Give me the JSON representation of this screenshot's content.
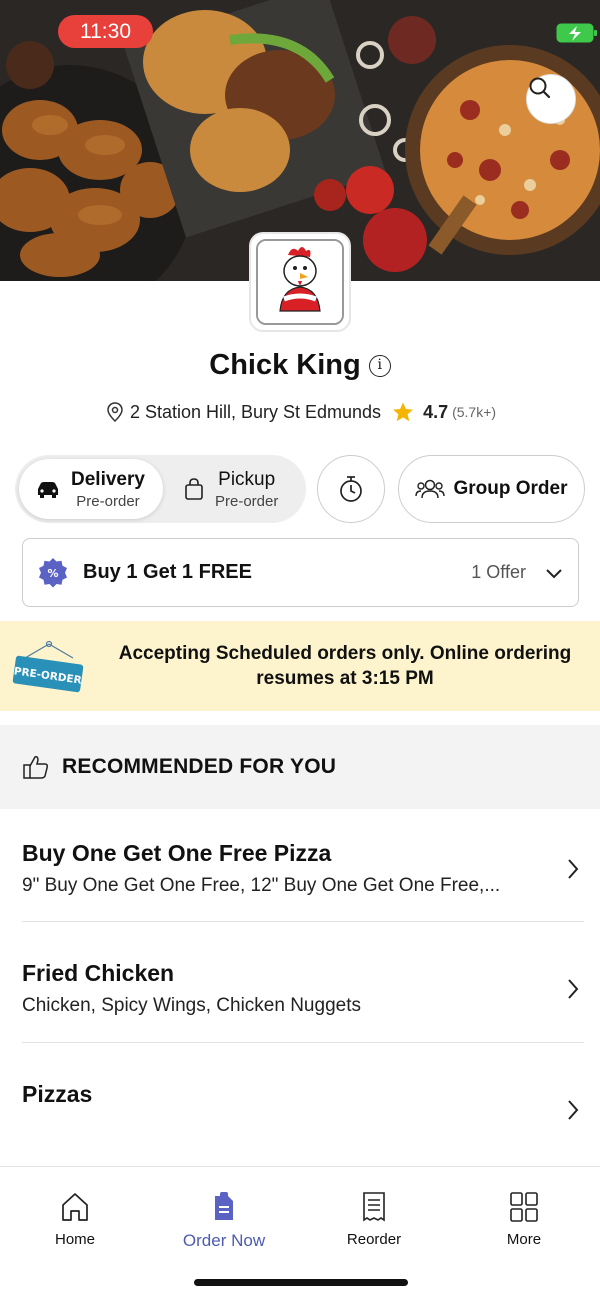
{
  "status_bar": {
    "time": "11:30"
  },
  "restaurant": {
    "name": "Chick King",
    "logo_text": "Chick King",
    "address": "2 Station Hill, Bury St Edmunds",
    "rating": "4.7",
    "rating_count": "(5.7k+)"
  },
  "order_mode": {
    "delivery_label": "Delivery",
    "delivery_sub": "Pre-order",
    "pickup_label": "Pickup",
    "pickup_sub": "Pre-order",
    "selected": "Delivery"
  },
  "group_order_label": "Group Order",
  "offer": {
    "title": "Buy 1 Get 1 FREE",
    "count": "1 Offer"
  },
  "banner": {
    "tag": "PRE-ORDER",
    "text": "Accepting Scheduled orders only. Online ordering resumes at 3:15 PM"
  },
  "recommended": {
    "title": "RECOMMENDED FOR YOU"
  },
  "categories": [
    {
      "name": "Buy One Get One Free Pizza",
      "desc": "9\" Buy One Get One Free, 12\" Buy One Get One Free,..."
    },
    {
      "name": "Fried Chicken",
      "desc": "Chicken, Spicy Wings, Chicken Nuggets"
    },
    {
      "name": "Pizzas",
      "desc": ""
    }
  ],
  "nav": [
    {
      "label": "Home",
      "icon": "home-icon"
    },
    {
      "label": "Order Now",
      "icon": "order-icon"
    },
    {
      "label": "Reorder",
      "icon": "receipt-icon"
    },
    {
      "label": "More",
      "icon": "grid-icon"
    }
  ],
  "colors": {
    "accent": "#4e5bb0",
    "status_time_bg": "#e8403a",
    "banner_bg": "#fdf4cd",
    "star": "#f5b400",
    "battery": "#3ec94a"
  }
}
